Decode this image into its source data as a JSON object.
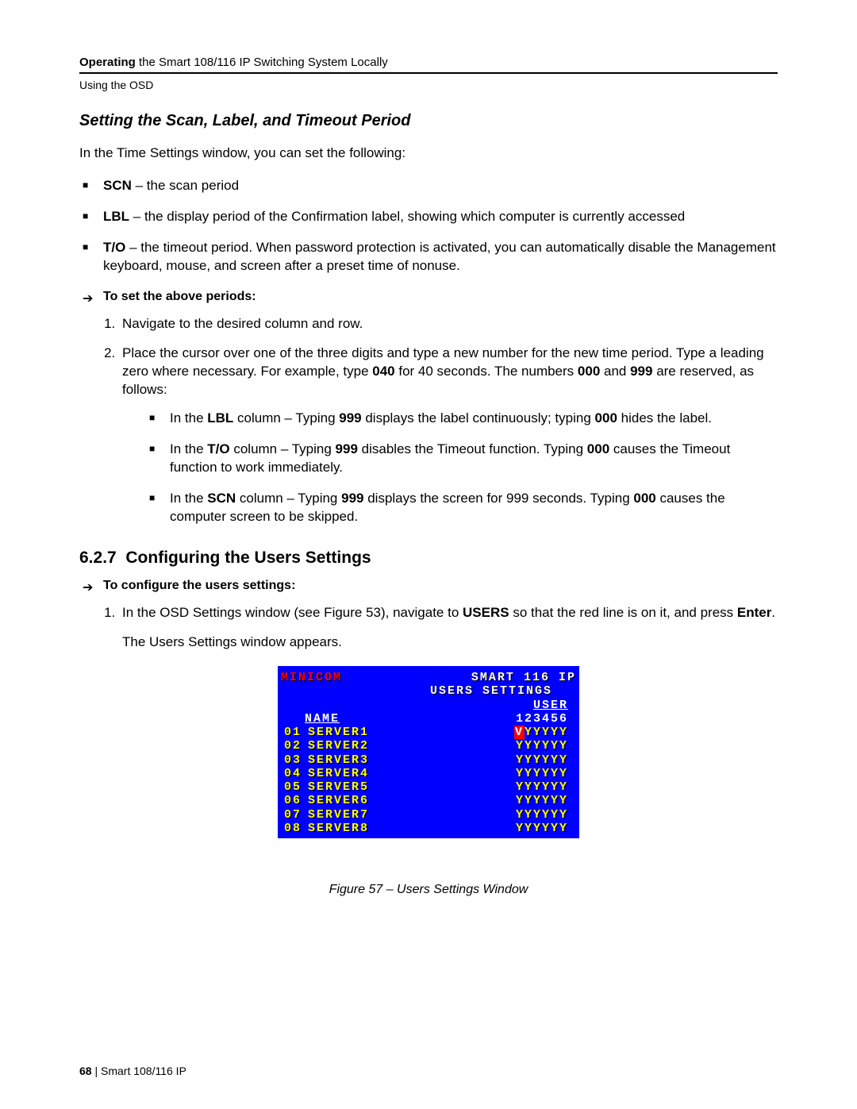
{
  "header": {
    "title_bold": "Operating",
    "title_rest": " the Smart 108/116 IP Switching System Locally",
    "subtitle": "Using the OSD"
  },
  "s1": {
    "title": "Setting the Scan, Label, and Timeout Period",
    "intro": "In the Time Settings window, you can set the following:",
    "bullets": {
      "b1_bold": "SCN",
      "b1_rest": " – the scan period",
      "b2_bold": "LBL",
      "b2_rest": " – the display period of the Confirmation label, showing which computer is currently accessed",
      "b3_bold": "T/O",
      "b3_rest": " – the timeout period. When password protection is activated, you can automatically disable the Management keyboard, mouse, and screen after a preset time of nonuse."
    },
    "arrow": "To set the above periods:",
    "step1": "Navigate to the desired column and row.",
    "step2_a": "Place the cursor over one of the three digits and type a new number for the new time period. Type a leading zero where necessary. For example, type ",
    "step2_040": "040",
    "step2_b": " for 40 seconds. The numbers ",
    "step2_000": "000",
    "step2_c": " and ",
    "step2_999": "999",
    "step2_d": " are reserved, as follows:",
    "sub": {
      "lbl_a": "In the ",
      "lbl_b": "LBL",
      "lbl_c": " column – Typing ",
      "lbl_d": "999",
      "lbl_e": " displays the label continuously; typing ",
      "lbl_f": "000",
      "lbl_g": " hides the label.",
      "to_a": "In the ",
      "to_b": "T/O",
      "to_c": " column – Typing ",
      "to_d": "999",
      "to_e": " disables the Timeout function. Typing ",
      "to_f": "000",
      "to_g": " causes the Timeout function to work immediately.",
      "scn_a": "In the ",
      "scn_b": "SCN",
      "scn_c": " column – Typing ",
      "scn_d": "999",
      "scn_e": " displays the screen for 999 seconds. Typing ",
      "scn_f": "000",
      "scn_g": " causes the computer screen to be skipped."
    }
  },
  "s2": {
    "num": "6.2.7",
    "title": "Configuring the Users Settings",
    "arrow": "To configure the users settings:",
    "step1_a": "In the OSD Settings window (see Figure 53), navigate to ",
    "step1_b": "USERS",
    "step1_c": " so that the red line is on it, and press ",
    "step1_d": "Enter",
    "step1_e": ".",
    "appears": "The Users Settings window appears."
  },
  "osd": {
    "brand": "MINICOM",
    "t1_a": "SMART",
    "t1_b": "116",
    "t1_c": "IP",
    "t2": "USERS SETTINGS",
    "col_name": "NAME",
    "col_user": "USER",
    "col_nums": "123456",
    "rows": [
      {
        "i": "01",
        "n": "SERVER1",
        "p": "VYYYYY",
        "first_red": true
      },
      {
        "i": "02",
        "n": "SERVER2",
        "p": "YYYYYY"
      },
      {
        "i": "03",
        "n": "SERVER3",
        "p": "YYYYYY"
      },
      {
        "i": "04",
        "n": "SERVER4",
        "p": "YYYYYY"
      },
      {
        "i": "05",
        "n": "SERVER5",
        "p": "YYYYYY"
      },
      {
        "i": "06",
        "n": "SERVER6",
        "p": "YYYYYY"
      },
      {
        "i": "07",
        "n": "SERVER7",
        "p": "YYYYYY"
      },
      {
        "i": "08",
        "n": "SERVER8",
        "p": "YYYYYY"
      }
    ]
  },
  "fig": "Figure 57 – Users Settings Window",
  "footer": {
    "page": "68",
    "text": "  |  Smart 108/116 IP"
  }
}
